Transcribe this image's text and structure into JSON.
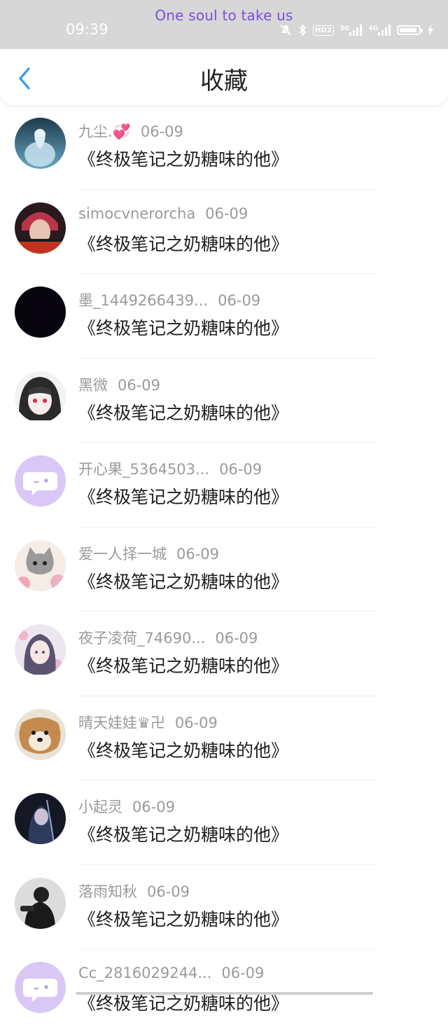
{
  "status_bar": {
    "banner": "One soul to take us",
    "time": "09:39",
    "hd_label": "HD2",
    "net_label_1": "5G",
    "net_label_2": "4G"
  },
  "header": {
    "title": "收藏",
    "back_icon": "chevron-left-icon",
    "accent": "#2f9bf0"
  },
  "favorites": [
    {
      "username": "九尘.💞",
      "date": "06-09",
      "work": "《终极笔记之奶糖味的他》",
      "avatar": "avatar-ghost-robe"
    },
    {
      "username": "simocvnerorcha",
      "date": "06-09",
      "work": "《终极笔记之奶糖味的他》",
      "avatar": "avatar-red-hair"
    },
    {
      "username": "墨_1449266439...",
      "date": "06-09",
      "work": "《终极笔记之奶糖味的他》",
      "avatar": "avatar-black"
    },
    {
      "username": "黑微",
      "date": "06-09",
      "work": "《终极笔记之奶糖味的他》",
      "avatar": "avatar-anime-girl"
    },
    {
      "username": "开心果_5364503...",
      "date": "06-09",
      "work": "《终极笔记之奶糖味的他》",
      "avatar": "avatar-default-chat"
    },
    {
      "username": "爱一人择一城",
      "date": "06-09",
      "work": "《终极笔记之奶糖味的他》",
      "avatar": "avatar-kitten"
    },
    {
      "username": "夜子凌荷_74690...",
      "date": "06-09",
      "work": "《终极笔记之奶糖味的他》",
      "avatar": "avatar-anime-purple"
    },
    {
      "username": "晴天娃娃♛卍",
      "date": "06-09",
      "work": "《终极笔记之奶糖味的他》",
      "avatar": "avatar-dog"
    },
    {
      "username": "小起灵",
      "date": "06-09",
      "work": "《终极笔记之奶糖味的他》",
      "avatar": "avatar-dark-figure"
    },
    {
      "username": "落雨知秋",
      "date": "06-09",
      "work": "《终极笔记之奶糖味的他》",
      "avatar": "avatar-silhouette"
    },
    {
      "username": "Cc_2816029244...",
      "date": "06-09",
      "work": "《终极笔记之奶糖味的他》",
      "avatar": "avatar-default-chat"
    }
  ]
}
